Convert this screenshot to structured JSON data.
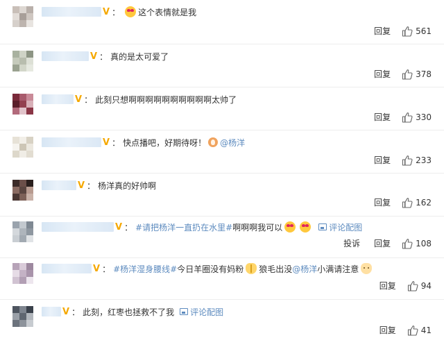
{
  "comments": [
    {
      "avatar": [
        "#c9bfb8",
        "#ddd7d2",
        "#b9b0aa",
        "#e3ddd8",
        "#a89f99",
        "#cfc7c1",
        "#d6d0cb",
        "#bdb4ae",
        "#e8e4e0"
      ],
      "name_width": 86,
      "content": [
        {
          "type": "emoji",
          "icon": "love-eyes-emoji"
        },
        {
          "type": "text",
          "value": "这个表情就是我"
        }
      ],
      "reply_label": "回复",
      "likes": "561"
    },
    {
      "avatar": [
        "#a9b2a0",
        "#cfd3c6",
        "#8d9584",
        "#c5cabb",
        "#b8bdae",
        "#dde0d6",
        "#9aa290",
        "#d2d6c9",
        "#e6e9e0"
      ],
      "name_width": 68,
      "content": [
        {
          "type": "text",
          "value": "真的是太可爱了"
        }
      ],
      "reply_label": "回复",
      "likes": "378"
    },
    {
      "avatar": [
        "#7a2a3a",
        "#a85a6c",
        "#c98a98",
        "#5a1e2a",
        "#93404f",
        "#d8b0b8",
        "#b26a7b",
        "#e1c3ca",
        "#8a3646"
      ],
      "name_width": 46,
      "content": [
        {
          "type": "text",
          "value": "此刻只想啊啊啊啊啊啊啊啊啊啊太帅了"
        }
      ],
      "reply_label": "回复",
      "likes": "330"
    },
    {
      "avatar": [
        "#e7e2d7",
        "#f2efe8",
        "#d8d2c4",
        "#f6f4ef",
        "#cdc6b6",
        "#ece8df",
        "#ddd8cb",
        "#f0ede6",
        "#e2ddd1"
      ],
      "name_width": 86,
      "content": [
        {
          "type": "text",
          "value": "快点播吧，好期待呀！"
        },
        {
          "type": "at-icon"
        },
        {
          "type": "link",
          "value": "@杨洋"
        }
      ],
      "reply_label": "回复",
      "likes": "233"
    },
    {
      "avatar": [
        "#3b2b28",
        "#6b4f49",
        "#2a1f1d",
        "#8a6b62",
        "#5a4540",
        "#b89b90",
        "#4a3733",
        "#7d6158",
        "#c9b2a8"
      ],
      "name_width": 50,
      "content": [
        {
          "type": "text",
          "value": "杨洋真的好帅啊"
        }
      ],
      "reply_label": "回复",
      "likes": "162"
    },
    {
      "avatar": [
        "#9aa3ad",
        "#c3c9cf",
        "#7f8993",
        "#d4d8dc",
        "#aeb5bc",
        "#8e97a0",
        "#c9ced3",
        "#a2aab2",
        "#e0e3e6"
      ],
      "name_width": 104,
      "content": [
        {
          "type": "link",
          "value": "#请把杨洋一直扔在水里#"
        },
        {
          "type": "text",
          "value": " 啊啊啊我可以"
        },
        {
          "type": "emoji",
          "icon": "love-eyes-emoji"
        },
        {
          "type": "emoji",
          "icon": "love-eyes-emoji"
        },
        {
          "type": "img-icon"
        },
        {
          "type": "link",
          "value": "评论配图"
        }
      ],
      "report_label": "投诉",
      "reply_label": "回复",
      "likes": "108"
    },
    {
      "avatar": [
        "#b7a3b8",
        "#d9cbd9",
        "#9d889f",
        "#e6dce6",
        "#c4b2c5",
        "#a994ab",
        "#d1c3d2",
        "#b29fb4",
        "#ede6ee"
      ],
      "name_width": 72,
      "content": [
        {
          "type": "link",
          "value": "#杨洋湿身腰线#"
        },
        {
          "type": "text",
          "value": " 今日羊圈没有妈粉"
        },
        {
          "type": "emoji",
          "icon": "pray-emoji"
        },
        {
          "type": "text",
          "value": "狼毛出没"
        },
        {
          "type": "link",
          "value": "@杨洋"
        },
        {
          "type": "text",
          "value": " 小满请注意"
        },
        {
          "type": "emoji",
          "icon": "cat-emoji"
        }
      ],
      "reply_label": "回复",
      "likes": "94"
    },
    {
      "avatar": [
        "#4e5560",
        "#7e858f",
        "#3a414b",
        "#9aa0a8",
        "#5f6670",
        "#b2b7bd",
        "#6c737d",
        "#8d939b",
        "#c7cbd0"
      ],
      "name_width": 28,
      "content": [
        {
          "type": "text",
          "value": "此刻，红枣也拯救不了我"
        },
        {
          "type": "img-icon"
        },
        {
          "type": "link",
          "value": "评论配图"
        }
      ],
      "reply_label": "回复",
      "likes": "41"
    }
  ],
  "colors": {
    "link": "#5d8bbf",
    "vip_badge": "#f5a800",
    "text": "#333333",
    "divider": "#ededed"
  },
  "vip_badge_text": "V",
  "colon_text": "："
}
